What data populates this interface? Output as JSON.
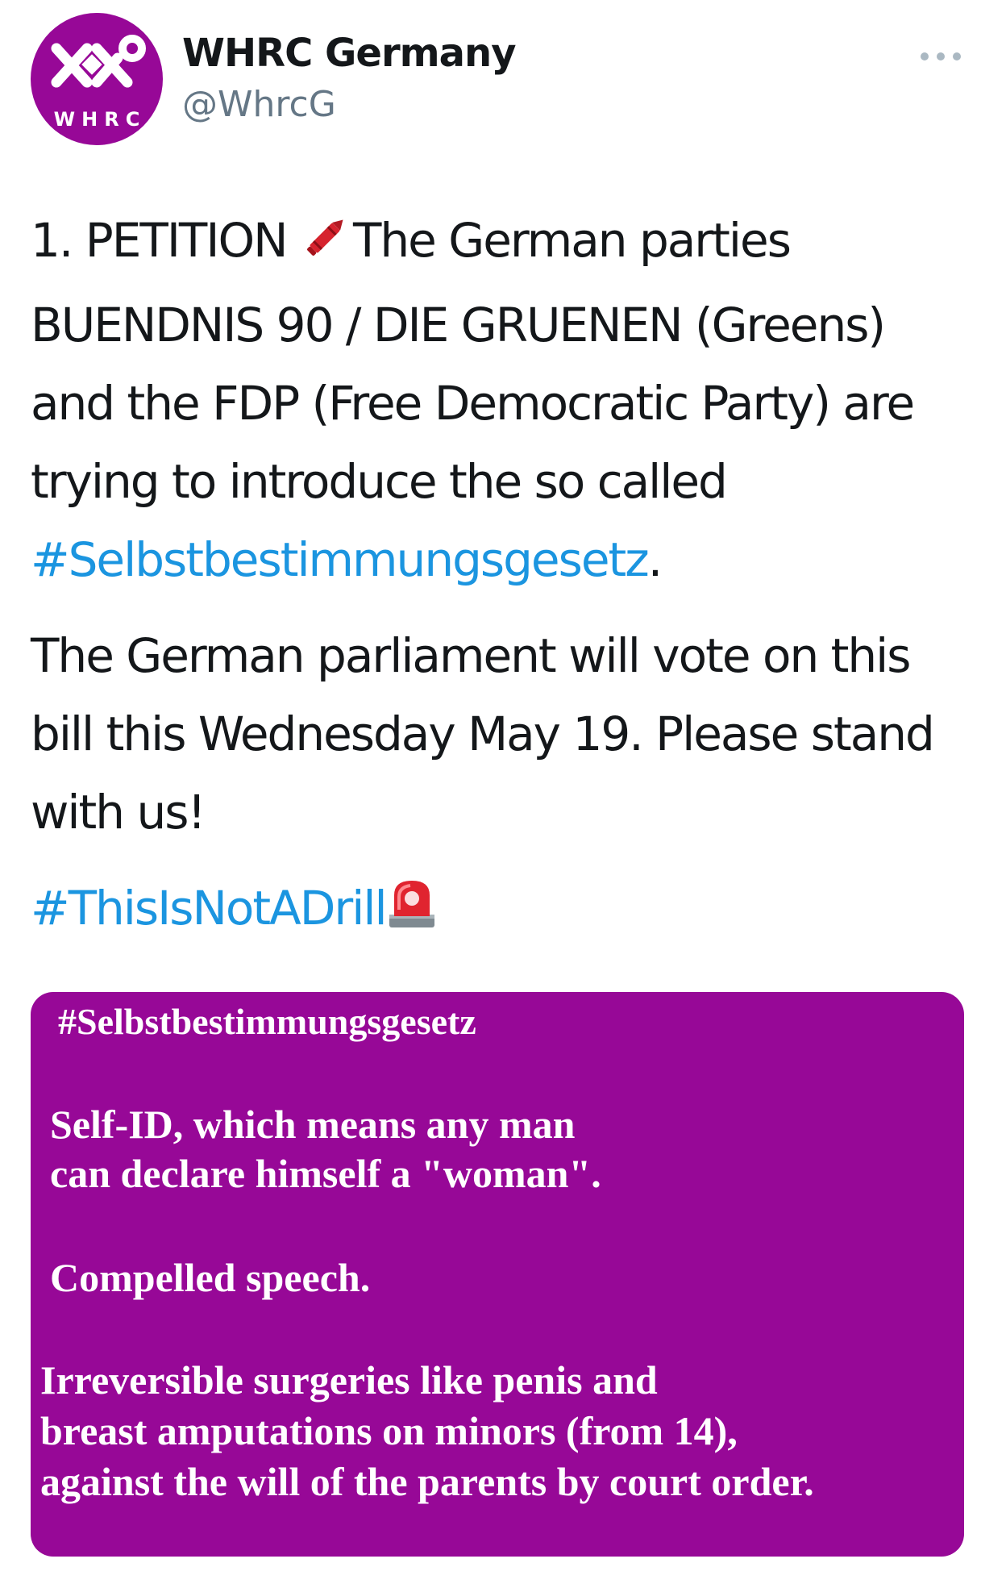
{
  "user": {
    "avatar_text": "WHRC",
    "display_name": "WHRC Germany",
    "handle": "@WhrcG"
  },
  "icons": {
    "more": "more-options-icon",
    "crayon": "crayon-emoji",
    "siren": "police-light-emoji"
  },
  "colors": {
    "brand_purple": "#970897",
    "hashtag_blue": "#1b95e0",
    "text": "#14171a",
    "muted": "#657786"
  },
  "tweet": {
    "p1_start": "1. PETITION ",
    "p1_middle": "The German parties BUENDNIS 90 / DIE GRUENEN (Greens) and the FDP (Free Democratic Party) are trying to introduce the so called ",
    "p1_hashtag": "#Selbstbestimmungsgesetz",
    "p1_end": ".",
    "p2": "The German parliament will vote on this bill this Wednesday May 19. Please stand with us!",
    "p3_hashtag": "#ThisIsNotADrill"
  },
  "image_card": {
    "title": "#Selbstbestimmungsgesetz",
    "line1": "Self-ID, which means any man",
    "line2": "can declare himself a \"woman\".",
    "line3": "Compelled speech.",
    "line4": "Irreversible surgeries like penis and",
    "line5": "breast amputations on minors (from 14),",
    "line6": "against the will of the parents by court order."
  }
}
